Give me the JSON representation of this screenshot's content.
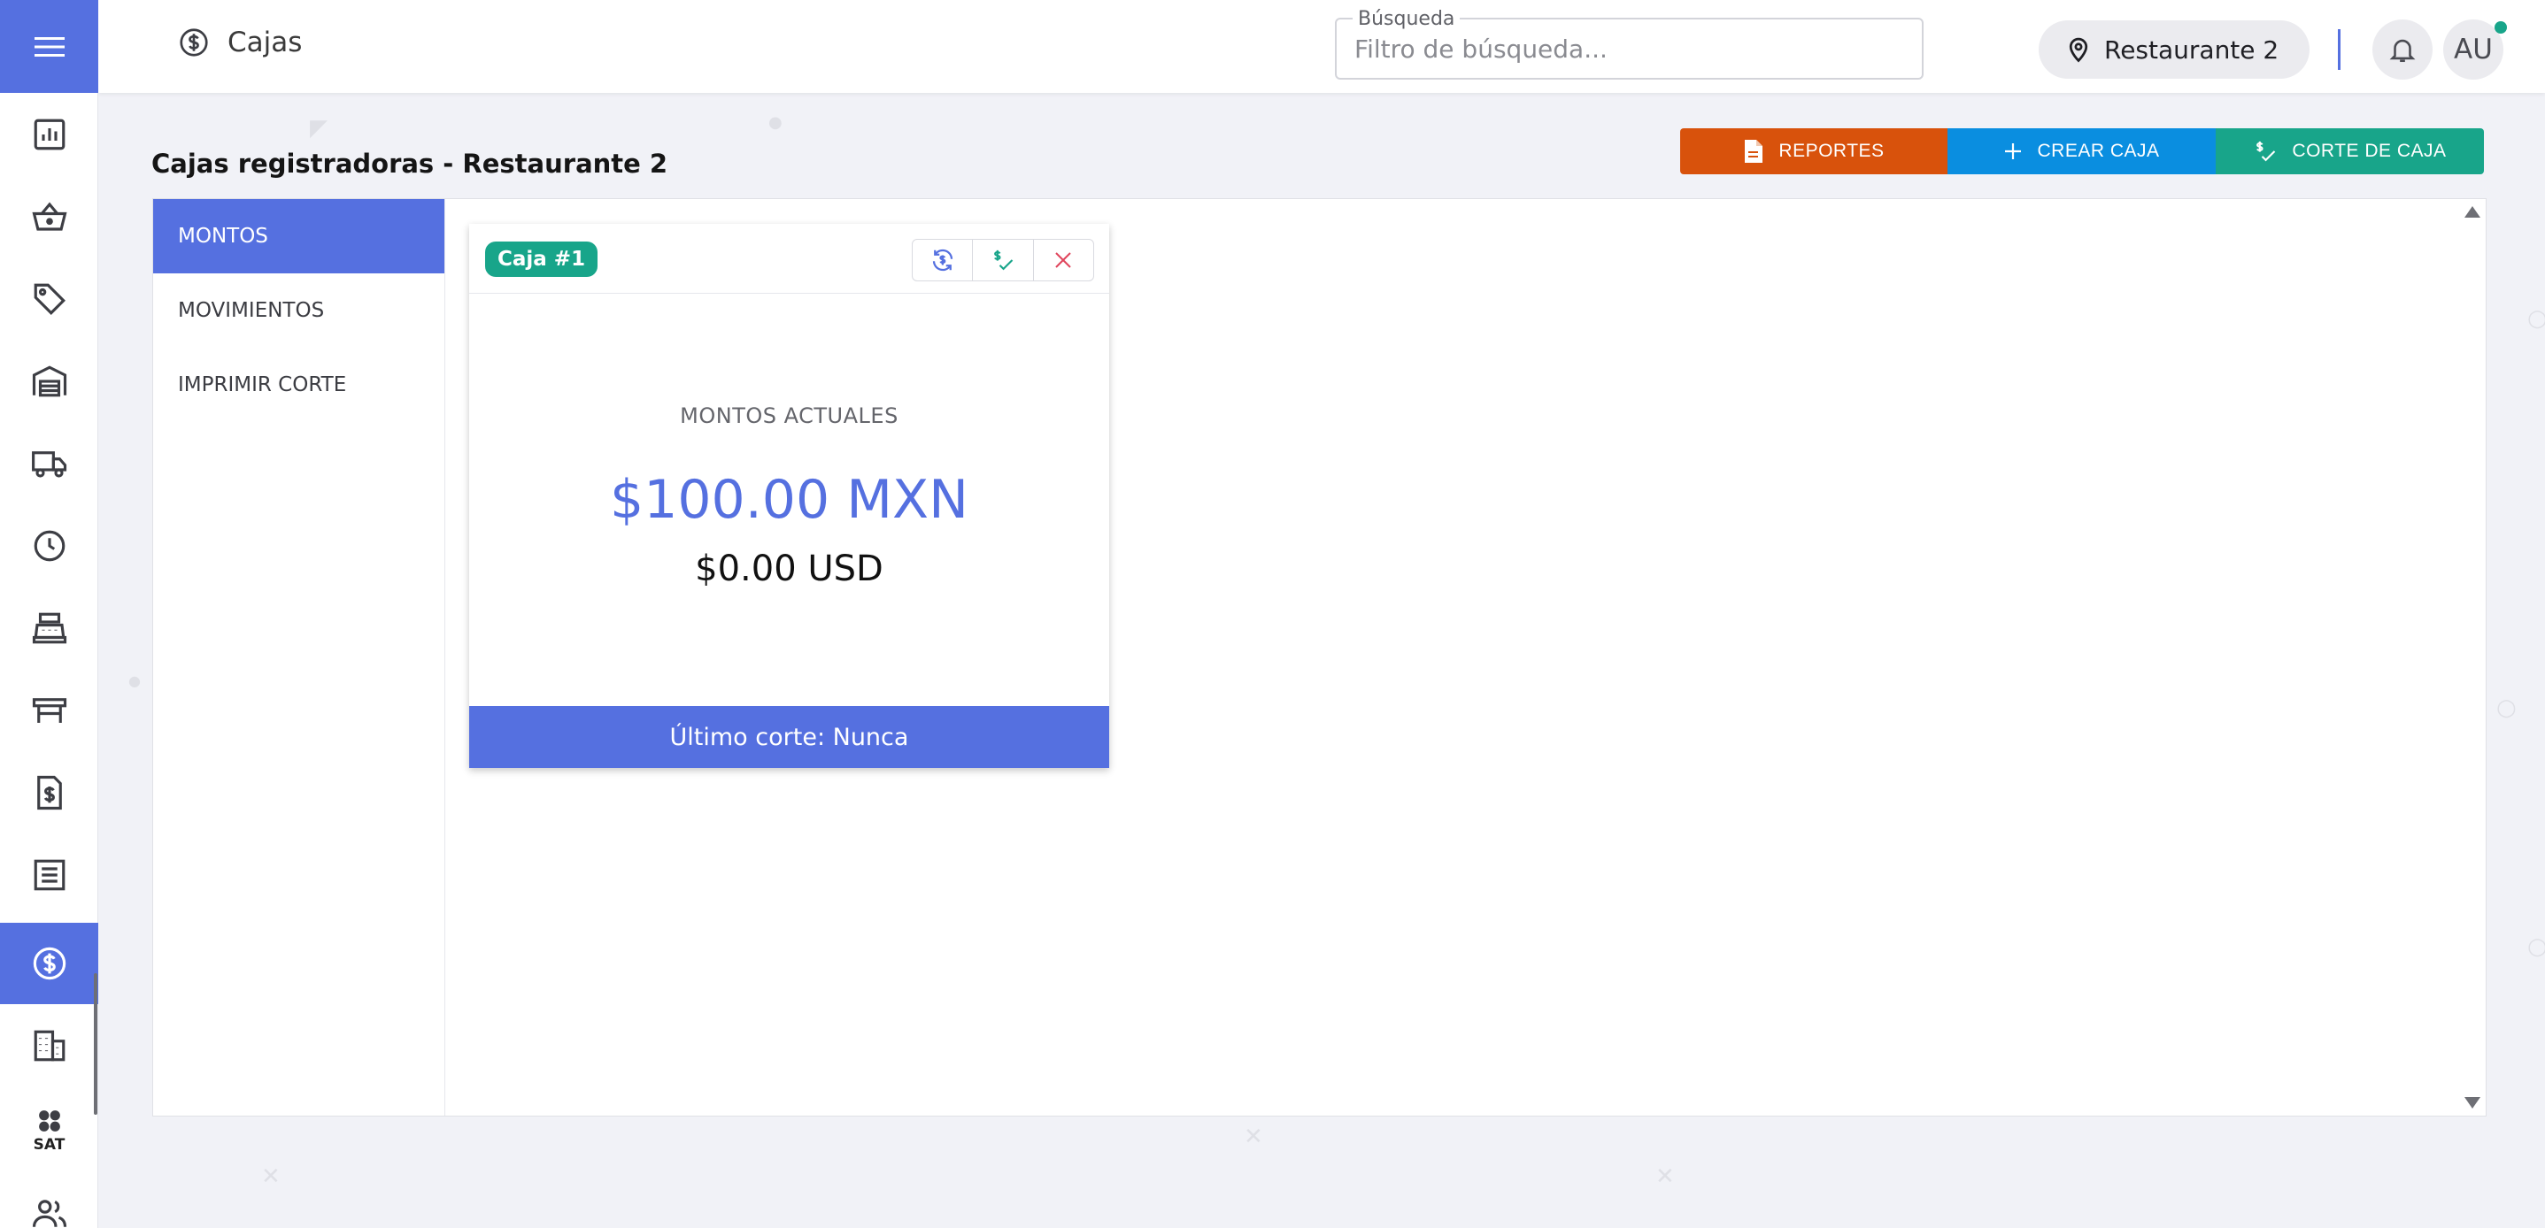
{
  "header": {
    "title": "Cajas",
    "search": {
      "label": "Búsqueda",
      "placeholder": "Filtro de búsqueda..."
    },
    "location": "Restaurante 2",
    "user_initials": "AU"
  },
  "sidebar": {
    "items": [
      {
        "name": "dashboard",
        "icon": "bar-chart-icon"
      },
      {
        "name": "ventas",
        "icon": "basket-icon"
      },
      {
        "name": "productos",
        "icon": "tag-icon"
      },
      {
        "name": "almacen",
        "icon": "warehouse-icon"
      },
      {
        "name": "envios",
        "icon": "truck-icon"
      },
      {
        "name": "historial",
        "icon": "clock-icon"
      },
      {
        "name": "cajero",
        "icon": "cash-register-icon"
      },
      {
        "name": "mesas",
        "icon": "table-icon"
      },
      {
        "name": "facturas",
        "icon": "invoice-icon"
      },
      {
        "name": "reportes",
        "icon": "list-icon"
      },
      {
        "name": "cajas",
        "icon": "dollar-circle-icon",
        "active": true
      },
      {
        "name": "empresas",
        "icon": "building-icon"
      },
      {
        "name": "sat",
        "icon": "sat-icon",
        "text": "SAT"
      },
      {
        "name": "usuarios",
        "icon": "users-icon"
      }
    ]
  },
  "main": {
    "title": "Cajas registradoras - Restaurante 2",
    "actions": {
      "reportes": "REPORTES",
      "crear_caja": "CREAR CAJA",
      "corte_de_caja": "CORTE DE CAJA"
    },
    "tabs": [
      {
        "label": "MONTOS",
        "active": true
      },
      {
        "label": "MOVIMIENTOS"
      },
      {
        "label": "IMPRIMIR CORTE"
      }
    ],
    "card": {
      "badge": "Caja #1",
      "amount_label": "MONTOS ACTUALES",
      "amount_mxn": "$100.00 MXN",
      "amount_usd": "$0.00 USD",
      "footer": "Último corte: Nunca"
    }
  },
  "colors": {
    "primary": "#5570e0",
    "orange": "#d8520c",
    "blue": "#0a8ee0",
    "green": "#18a58a",
    "background": "#f1f2f7"
  }
}
